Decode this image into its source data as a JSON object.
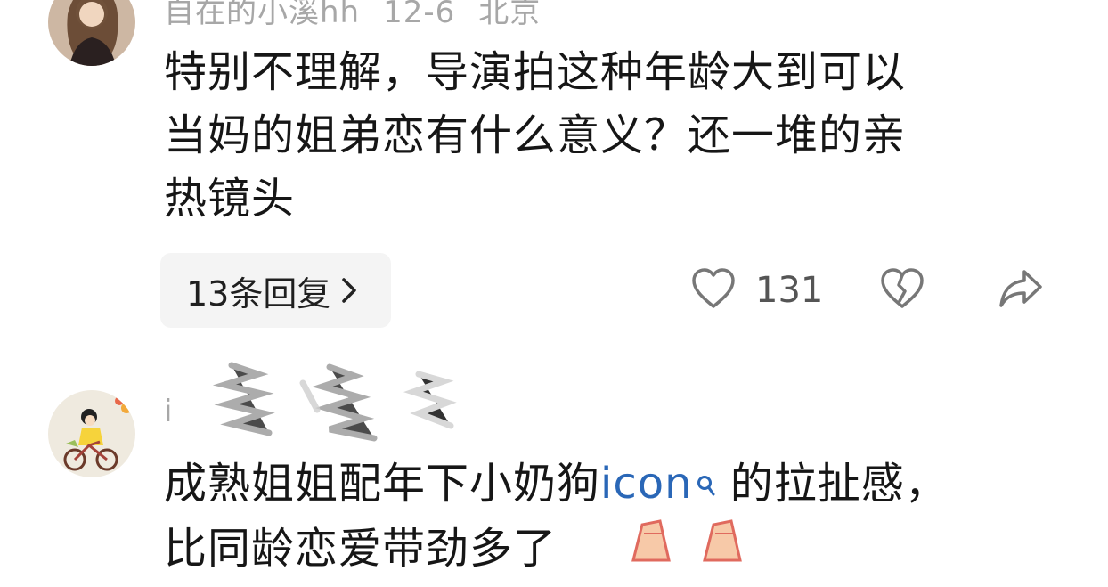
{
  "comments": [
    {
      "meta": {
        "username": "自在的小溪hh",
        "date": "12-6",
        "location": "北京"
      },
      "text_lines": [
        "特别不理解，导演拍这种年龄大到可以",
        "当妈的姐弟恋有什么意义？还一堆的亲",
        "热镜头"
      ],
      "reply_button_label": "13条回复",
      "like_count": "131",
      "icons": [
        "heart-icon",
        "broken-heart-icon",
        "share-arrow-icon",
        "chevron-right-icon"
      ]
    },
    {
      "meta": {
        "username": "i"
      },
      "text_parts": {
        "before": "成熟姐姐配年下小奶狗",
        "link": "icon",
        "after": " 的拉扯感，"
      },
      "text_line2": "比同龄恋爱带劲多了",
      "icons": [
        "search-icon",
        "clapping-hands-emoji"
      ]
    }
  ],
  "colors": {
    "text": "#161616",
    "meta": "#a7a7a7",
    "link": "#2a67b7",
    "reply_bg": "#f4f4f4"
  }
}
